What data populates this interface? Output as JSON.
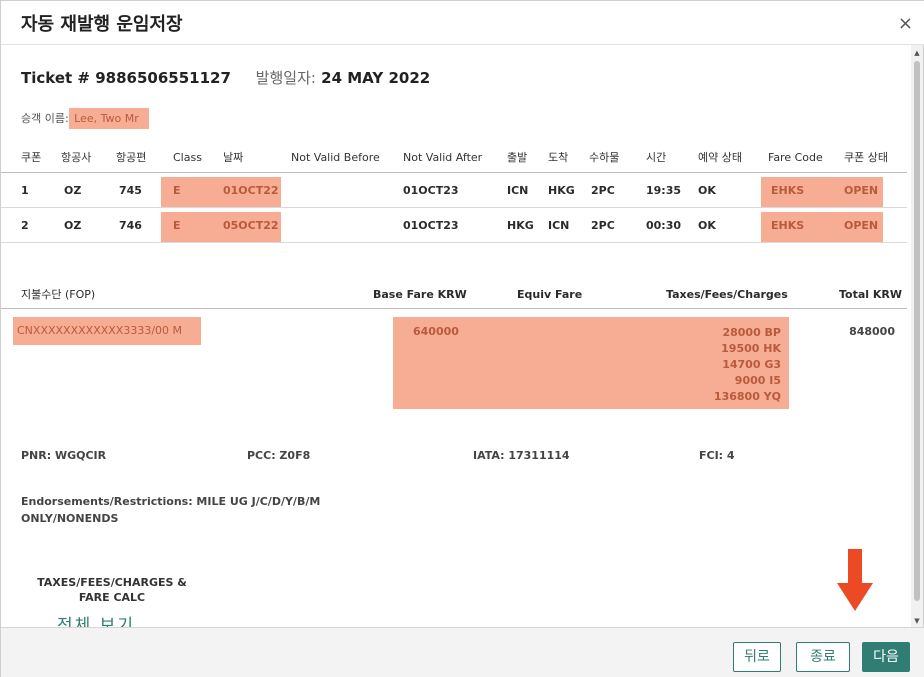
{
  "dialog": {
    "title": "자동 재발행 운임저장",
    "close_label": "×"
  },
  "ticket": {
    "number_text": "Ticket # 9886506551127",
    "issue_label": "발행일자:",
    "issue_date": " 24 MAY 2022",
    "passenger_label": "승객 이름:",
    "passenger_name": " Lee, Two Mr"
  },
  "coupons": {
    "headers": [
      "쿠폰",
      "항공사",
      "항공편",
      "Class",
      "날짜",
      "Not Valid Before",
      "Not Valid After",
      "출발",
      "도착",
      "수하물",
      "시간",
      "예약 상태",
      "Fare Code",
      "쿠폰 상태"
    ],
    "rows": [
      {
        "coupon": "1",
        "airline": "OZ",
        "flight": "745",
        "class": "E",
        "date": "01OCT22",
        "nvb": "",
        "nva": "01OCT23",
        "from": "ICN",
        "to": "HKG",
        "baggage": "2PC",
        "time": "19:35",
        "status": "OK",
        "fare_code": "EHKS",
        "coupon_status": "OPEN"
      },
      {
        "coupon": "2",
        "airline": "OZ",
        "flight": "746",
        "class": "E",
        "date": "05OCT22",
        "nvb": "",
        "nva": "01OCT23",
        "from": "HKG",
        "to": "ICN",
        "baggage": "2PC",
        "time": "00:30",
        "status": "OK",
        "fare_code": "EHKS",
        "coupon_status": "OPEN"
      }
    ]
  },
  "payment": {
    "headers": {
      "fop": "지불수단 (FOP)",
      "base": "Base Fare KRW",
      "equiv": "Equiv Fare",
      "taxes": "Taxes/Fees/Charges",
      "total": "Total KRW"
    },
    "fop_value": "CNXXXXXXXXXXXX3333/00 M",
    "base_fare": "640000",
    "taxes": [
      "28000 BP",
      "19500 HK",
      "14700 G3",
      "9000 I5",
      "136800 YQ"
    ],
    "total": "848000"
  },
  "info": {
    "pnr": "PNR: WGQCIR",
    "pcc": "PCC: Z0F8",
    "iata": "IATA: 17311114",
    "fci": "FCI: 4",
    "endorsements_line1": "Endorsements/Restrictions: MILE UG J/C/D/Y/B/M",
    "endorsements_line2": "ONLY/NONENDS"
  },
  "calc": {
    "title_line1": "TAXES/FEES/CHARGES &",
    "title_line2": "FARE CALC",
    "view_all": "전체 보기"
  },
  "footer": {
    "back": "뒤로",
    "exit": "종료",
    "next": "다음"
  },
  "colors": {
    "accent": "#2f7d73",
    "highlight": "#f7ad94",
    "arrow": "#ec4a25"
  }
}
